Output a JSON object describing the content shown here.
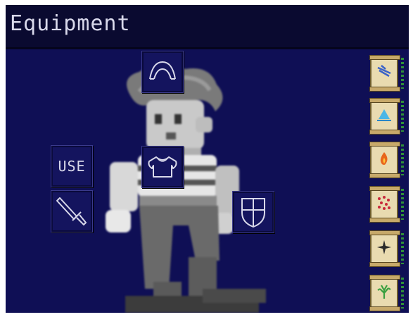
{
  "window": {
    "title": "Equipment"
  },
  "slots": {
    "head": {
      "icon": "helmet-icon"
    },
    "body": {
      "icon": "armor-icon"
    },
    "use": {
      "label": "USE"
    },
    "weapon": {
      "icon": "sword-icon"
    },
    "shield": {
      "icon": "shield-icon"
    }
  },
  "spells": [
    {
      "name": "wind-spell",
      "icon": "wind-icon",
      "color": "#3a62c8"
    },
    {
      "name": "water-spell",
      "icon": "water-icon",
      "color": "#4ab6e6"
    },
    {
      "name": "fire-spell",
      "icon": "fire-icon",
      "color": "#e8661c"
    },
    {
      "name": "scatter-spell",
      "icon": "scatter-icon",
      "color": "#c8283a"
    },
    {
      "name": "star-spell",
      "icon": "star-icon",
      "color": "#2a2a2a"
    },
    {
      "name": "plant-spell",
      "icon": "plant-icon",
      "color": "#3aa040"
    }
  ]
}
